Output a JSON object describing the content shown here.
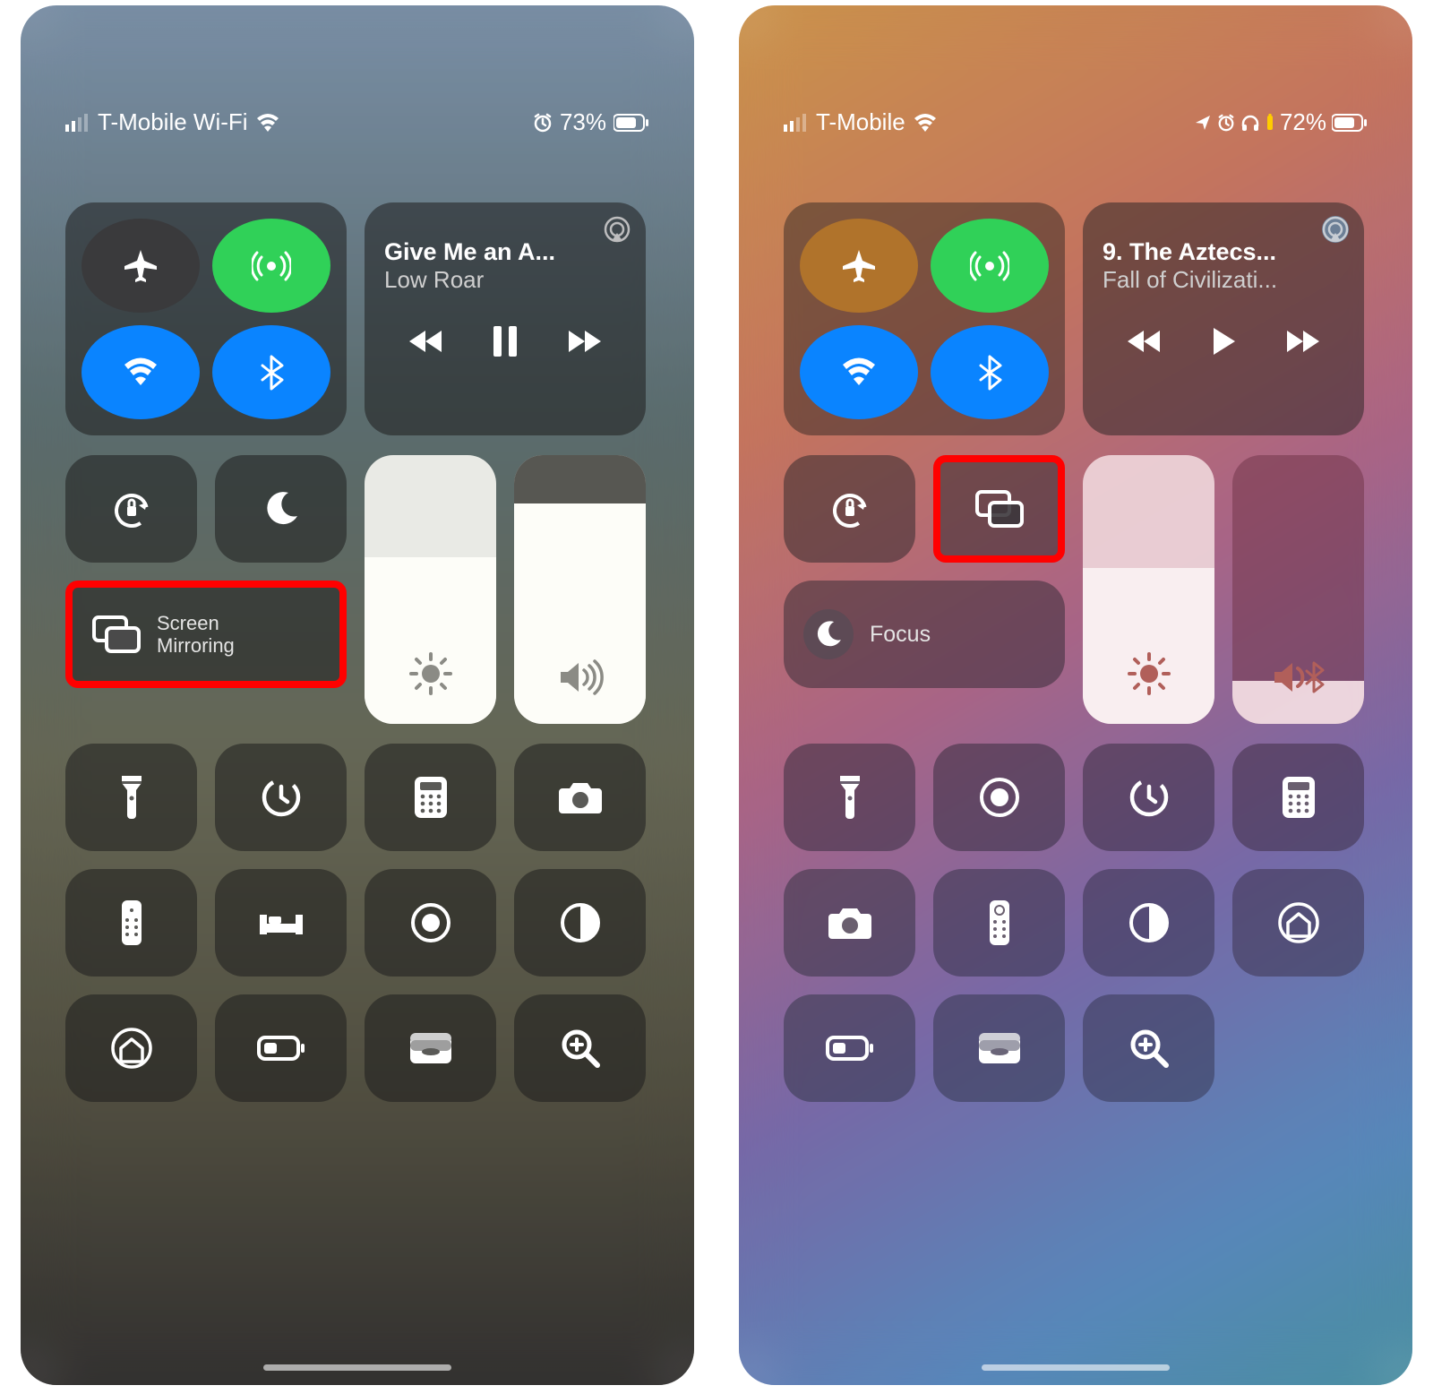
{
  "left": {
    "status": {
      "carrier": "T-Mobile Wi-Fi",
      "battery": "73%"
    },
    "media": {
      "title": "Give Me an A...",
      "sub": "Low Roar",
      "playing": true
    },
    "screen_mirroring": {
      "line1": "Screen",
      "line2": "Mirroring"
    },
    "brightness": 0.62,
    "volume": 0.82,
    "toggles": [
      "flashlight",
      "timer",
      "calculator",
      "camera",
      "remote",
      "bed",
      "record",
      "dark-mode",
      "home",
      "low-power",
      "wallet",
      "magnifier"
    ]
  },
  "right": {
    "status": {
      "carrier": "T-Mobile",
      "battery": "72%"
    },
    "media": {
      "title": "9. The Aztecs...",
      "sub": "Fall of Civilizati...",
      "playing": false
    },
    "focus_label": "Focus",
    "brightness": 0.58,
    "volume": 0.16,
    "toggles": [
      "flashlight",
      "record",
      "timer",
      "calculator",
      "camera",
      "remote",
      "dark-mode",
      "home",
      "low-power",
      "wallet",
      "magnifier"
    ]
  }
}
